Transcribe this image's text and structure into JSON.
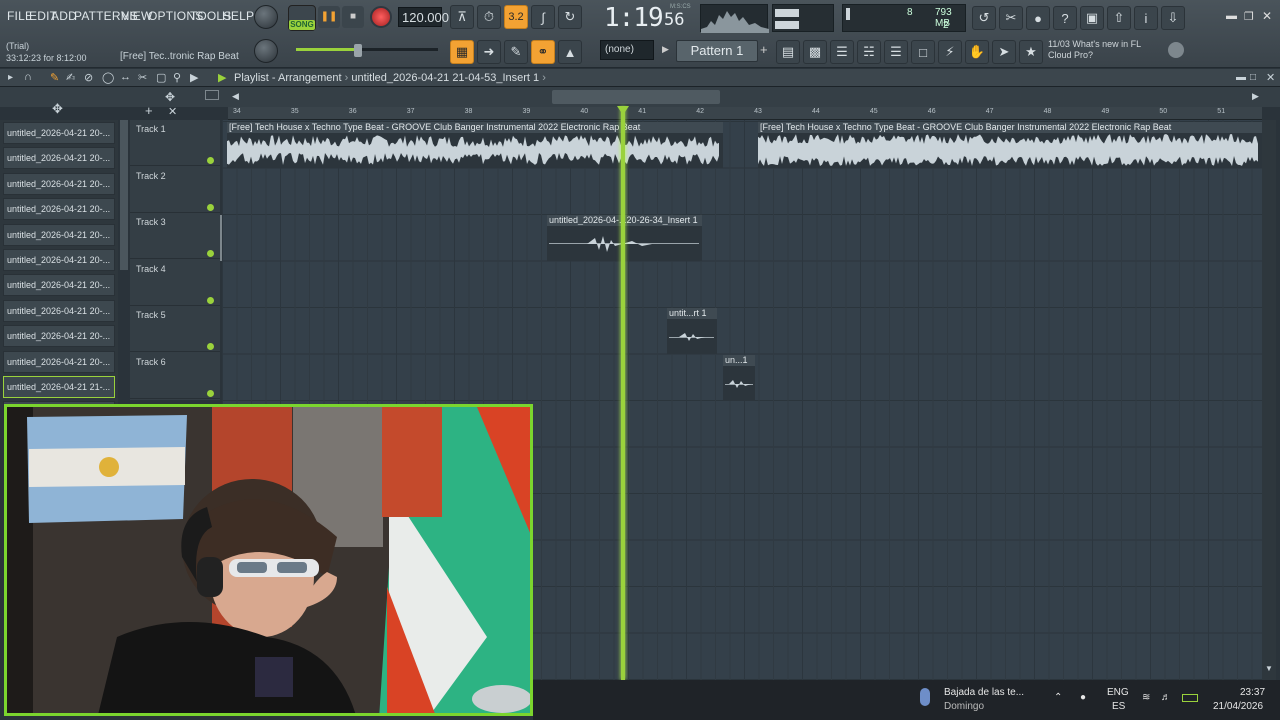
{
  "menu": [
    "FILE",
    "EDIT",
    "ADD",
    "PATTERNS",
    "VIEW",
    "OPTIONS",
    "TOOLS",
    "HELP"
  ],
  "transport": {
    "song_label": "SONG",
    "tempo": "120.000",
    "time": "1:19",
    "time_small": "56",
    "time_unit": "M:S:CS",
    "snap": "3.2"
  },
  "memory": {
    "cpu": "8",
    "ram": "793 MB",
    "poly": "2"
  },
  "trial": {
    "line1": "(Trial)",
    "line2": "33:12:23 for 8:12:00",
    "project": "[Free] Tec..tronic Rap Beat"
  },
  "pattern": {
    "none": "(none)",
    "name": "Pattern 1"
  },
  "news": {
    "line1": "11/03  What's new in FL",
    "line2": "Cloud Pro?"
  },
  "playlist": {
    "title": "Playlist - Arrangement",
    "breadcrumb": "untitled_2026-04-21 21-04-53_Insert 1"
  },
  "ruler": [
    "34",
    "35",
    "36",
    "37",
    "38",
    "39",
    "40",
    "41",
    "42",
    "43",
    "44",
    "45",
    "46",
    "47",
    "48",
    "49",
    "50",
    "51"
  ],
  "browser_items": [
    "untitled_2026-04-21 20-...",
    "untitled_2026-04-21 20-...",
    "untitled_2026-04-21 20-...",
    "untitled_2026-04-21 20-...",
    "untitled_2026-04-21 20-...",
    "untitled_2026-04-21 20-...",
    "untitled_2026-04-21 20-...",
    "untitled_2026-04-21 20-...",
    "untitled_2026-04-21 20-...",
    "untitled_2026-04-21 20-...",
    "untitled_2026-04-21 21-...",
    "untitled_2026-04-21 21-..."
  ],
  "tracks": [
    "Track 1",
    "Track 2",
    "Track 3",
    "Track 4",
    "Track 5",
    "Track 6"
  ],
  "clips": {
    "a": "[Free] Tech House x Techno Type Beat - GROOVE  Club Banger Instrumental 2022  Electronic Rap Beat",
    "b": "[Free] Tech House x Techno Type Beat - GROOVE  Club Banger Instrumental 2022  Electronic Rap Beat",
    "c": "untitled_2026-04-...20-26-34_Insert 1",
    "d": "untit...rt 1",
    "e": "un...1"
  },
  "taskbar": {
    "weather_title": "Bajada de las te...",
    "weather_sub": "Domingo",
    "lang1": "ENG",
    "lang2": "ES",
    "clock": "23:37",
    "date": "21/04/2026"
  },
  "colors": {
    "accent": "#9ad23c",
    "orange": "#f3a233",
    "webcam_border": "#7bd52e"
  }
}
